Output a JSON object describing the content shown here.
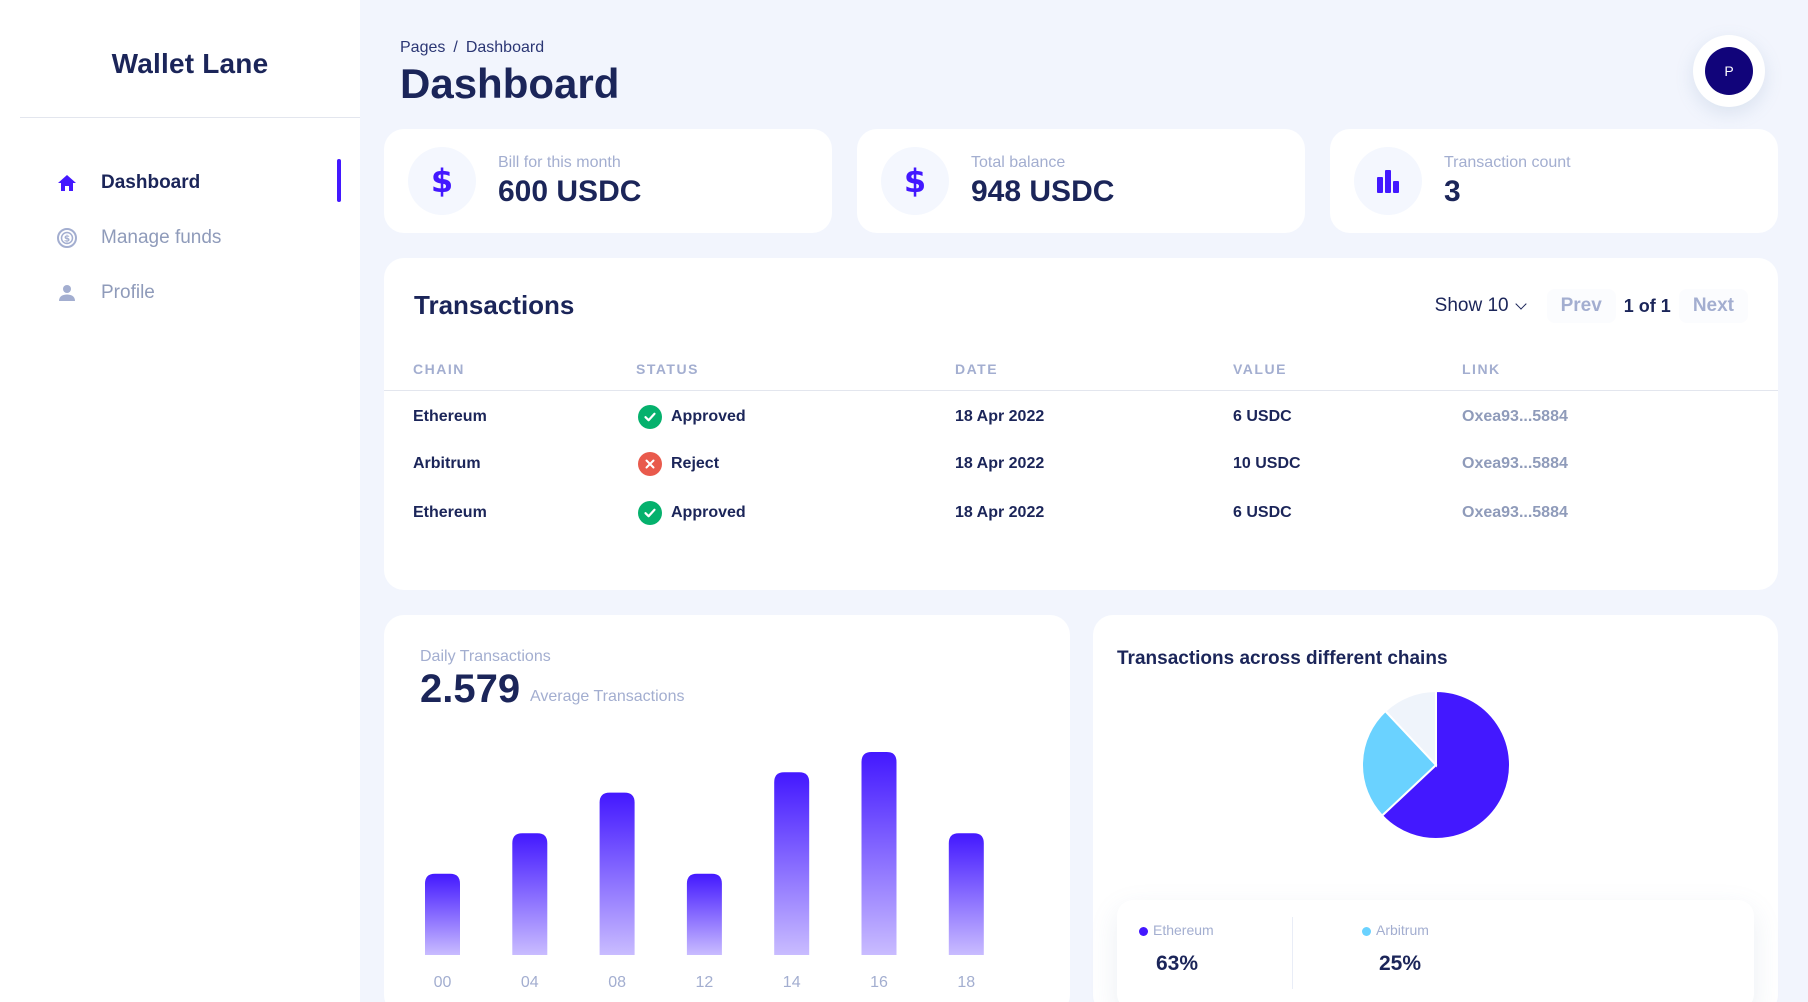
{
  "brand": "Wallet Lane",
  "sidebar": {
    "items": [
      {
        "label": "Dashboard",
        "icon": "home-icon",
        "active": true
      },
      {
        "label": "Manage funds",
        "icon": "dollar-circle-icon",
        "active": false
      },
      {
        "label": "Profile",
        "icon": "person-icon",
        "active": false
      }
    ]
  },
  "header": {
    "breadcrumb_root": "Pages",
    "breadcrumb_sep": "/",
    "breadcrumb_current": "Dashboard",
    "title": "Dashboard",
    "avatar_initial": "P"
  },
  "stats": [
    {
      "label": "Bill for this month",
      "value": "600 USDC",
      "icon": "dollar-icon"
    },
    {
      "label": "Total balance",
      "value": "948 USDC",
      "icon": "dollar-icon"
    },
    {
      "label": "Transaction count",
      "value": "3",
      "icon": "bar-chart-icon"
    }
  ],
  "transactions": {
    "title": "Transactions",
    "show_label": "Show 10",
    "prev_label": "Prev",
    "page_info": "1 of 1",
    "next_label": "Next",
    "columns": [
      "CHAIN",
      "STATUS",
      "DATE",
      "VALUE",
      "LINK"
    ],
    "rows": [
      {
        "chain": "Ethereum",
        "status": "Approved",
        "status_kind": "ok",
        "date": "18 Apr 2022",
        "value": "6 USDC",
        "link": "Oxea93...5884"
      },
      {
        "chain": "Arbitrum",
        "status": "Reject",
        "status_kind": "bad",
        "date": "18 Apr 2022",
        "value": "10 USDC",
        "link": "Oxea93...5884"
      },
      {
        "chain": "Ethereum",
        "status": "Approved",
        "status_kind": "ok",
        "date": "18 Apr 2022",
        "value": "6 USDC",
        "link": "Oxea93...5884"
      }
    ]
  },
  "daily": {
    "label": "Daily Transactions",
    "value": "2.579",
    "sub": "Average Transactions"
  },
  "chart_data": [
    {
      "type": "bar",
      "title": "",
      "categories": [
        "00",
        "04",
        "08",
        "12",
        "14",
        "16",
        "18"
      ],
      "values": [
        40,
        60,
        80,
        40,
        90,
        100,
        60
      ],
      "ylim": [
        0,
        100
      ],
      "grid": false,
      "color_top": "#4318ff",
      "color_bottom": "#c9bcff"
    },
    {
      "type": "pie",
      "title": "Transactions across different chains",
      "slices": [
        {
          "name": "Ethereum",
          "value": 63,
          "color": "#4318ff"
        },
        {
          "name": "Arbitrum",
          "value": 25,
          "color": "#6ad2ff"
        },
        {
          "name": "",
          "value": 12,
          "color": "#eff4fb"
        }
      ],
      "legend": [
        {
          "name": "Ethereum",
          "value": "63%",
          "color": "#4318ff"
        },
        {
          "name": "Arbitrum",
          "value": "25%",
          "color": "#6ad2ff"
        }
      ]
    }
  ],
  "colors": {
    "accent": "#4318ff",
    "navy": "#11047a",
    "approved": "#05b16d",
    "reject": "#e95a4c"
  }
}
